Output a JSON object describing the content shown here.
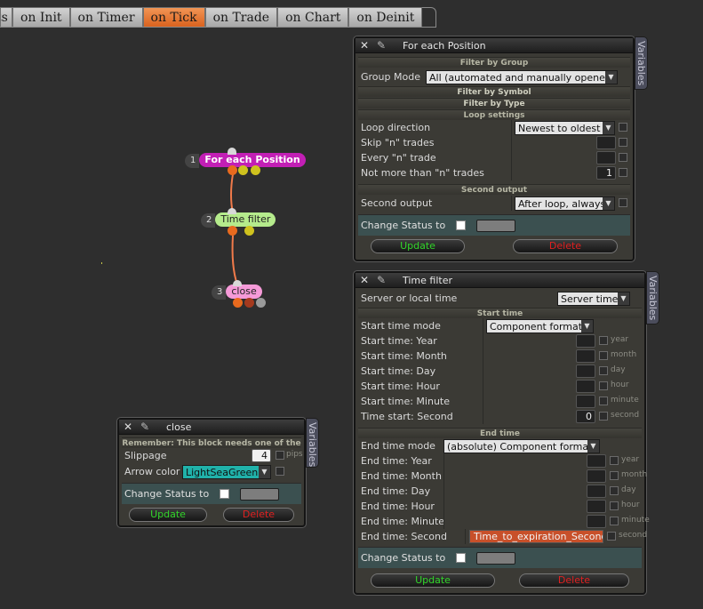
{
  "tabs": [
    {
      "label": "ts",
      "active": false
    },
    {
      "label": "on Init",
      "active": false
    },
    {
      "label": "on Timer",
      "active": false
    },
    {
      "label": "on Tick",
      "active": true
    },
    {
      "label": "on Trade",
      "active": false
    },
    {
      "label": "on Chart",
      "active": false
    },
    {
      "label": "on Deinit",
      "active": false
    }
  ],
  "graph": {
    "nodes": [
      {
        "num": "1",
        "label": "For each Position"
      },
      {
        "num": "2",
        "label": "Time filter"
      },
      {
        "num": "3",
        "label": "close"
      }
    ]
  },
  "common": {
    "variables_tab": "Variables",
    "change_status_label": "Change Status to",
    "update_label": "Update",
    "delete_label": "Delete"
  },
  "each_position": {
    "title": "For each Position",
    "filter_by_group": "Filter by Group",
    "group_mode_label": "Group Mode",
    "group_mode_value": "All (automated and manually opened)",
    "filter_by_symbol": "Filter by Symbol",
    "filter_by_type": "Filter by Type",
    "loop_settings": "Loop settings",
    "loop_direction_label": "Loop direction",
    "loop_direction_value": "Newest to oldest",
    "skip_label": "Skip \"n\" trades",
    "every_label": "Every \"n\" trade",
    "not_more_label": "Not more than \"n\" trades",
    "not_more_value": "1",
    "second_output_section": "Second output",
    "second_output_label": "Second output",
    "second_output_value": "After loop, always"
  },
  "time_filter": {
    "title": "Time filter",
    "server_label": "Server or local time",
    "server_value": "Server time",
    "start_section": "Start time",
    "start_mode_label": "Start time mode",
    "start_mode_value": "Component format",
    "start_rows": [
      {
        "label": "Start time: Year",
        "unit": "year",
        "value": ""
      },
      {
        "label": "Start time: Month",
        "unit": "month",
        "value": ""
      },
      {
        "label": "Start time: Day",
        "unit": "day",
        "value": ""
      },
      {
        "label": "Start time: Hour",
        "unit": "hour",
        "value": ""
      },
      {
        "label": "Start time: Minute",
        "unit": "minute",
        "value": ""
      },
      {
        "label": "Time start: Second",
        "unit": "second",
        "value": "0"
      }
    ],
    "end_section": "End time",
    "end_mode_label": "End time mode",
    "end_mode_value": "(absolute) Component format",
    "end_rows": [
      {
        "label": "End time: Year",
        "unit": "year",
        "value": ""
      },
      {
        "label": "End time: Month",
        "unit": "month",
        "value": ""
      },
      {
        "label": "End time: Day",
        "unit": "day",
        "value": ""
      },
      {
        "label": "End time: Hour",
        "unit": "hour",
        "value": ""
      },
      {
        "label": "End time: Minute",
        "unit": "minute",
        "value": ""
      }
    ],
    "end_second_label": "End time: Second",
    "end_second_value": "Time_to_expiration_Seconds",
    "end_second_unit": "second"
  },
  "close": {
    "title": "close",
    "remember_note": "Remember: This block needs one of the",
    "slippage_label": "Slippage",
    "slippage_value": "4",
    "slippage_unit": "pips",
    "arrow_color_label": "Arrow color",
    "arrow_color_value": "LightSeaGreen"
  },
  "colors": {
    "active_tab": "#e9772f",
    "node1": "#c21fb5",
    "node2": "#b5eb8c",
    "node3": "#f59ad8",
    "link": "#f07a4a",
    "update": "#32d52a",
    "delete": "#e02020",
    "light_sea_green": "#20b2aa",
    "variable_field": "#c8502a"
  }
}
